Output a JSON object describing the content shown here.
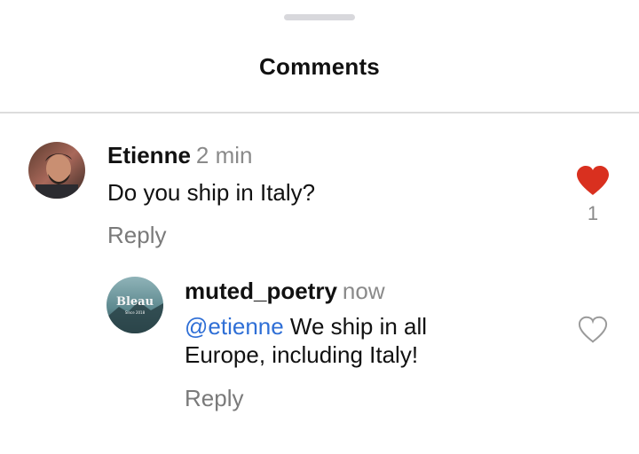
{
  "header": {
    "title": "Comments"
  },
  "comments": [
    {
      "username": "Etienne",
      "time": "2 min",
      "text": "Do you ship in Italy?",
      "reply_label": "Reply",
      "liked": true,
      "like_count": "1",
      "avatar_icon": "person-photo-avatar"
    }
  ],
  "replies": [
    {
      "username": "muted_poetry",
      "time": "now",
      "mention": "@etienne",
      "text": " We ship in all Europe, including Italy!",
      "reply_label": "Reply",
      "liked": false,
      "avatar_icon": "bleau-brand-avatar",
      "avatar_brand_text": "Bleau",
      "avatar_brand_subtext": "Since 2018"
    }
  ],
  "colors": {
    "like_active": "#d9301f",
    "mention": "#2f6fd6",
    "muted_text": "#8a8a8a"
  }
}
